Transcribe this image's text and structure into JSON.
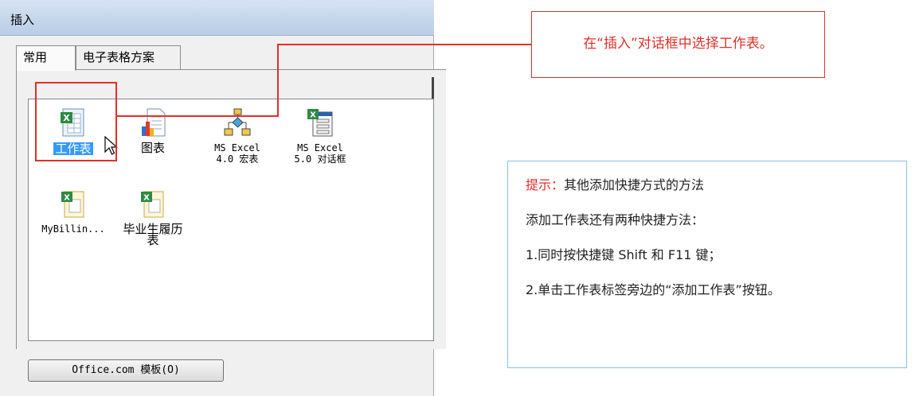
{
  "window": {
    "title": "插入"
  },
  "tabs": [
    {
      "label": "常用",
      "active": true
    },
    {
      "label": "电子表格方案",
      "active": false
    }
  ],
  "items": [
    {
      "label": "工作表",
      "icon": "excel-worksheet-icon",
      "selected": true
    },
    {
      "label": "图表",
      "icon": "chart-icon",
      "selected": false
    },
    {
      "label": "MS Excel\n4.0 宏表",
      "icon": "macro-sheet-icon",
      "selected": false
    },
    {
      "label": "MS Excel\n5.0 对话框",
      "icon": "dialog-sheet-icon",
      "selected": false
    },
    {
      "label": "MyBillin...",
      "icon": "excel-template-icon",
      "selected": false
    },
    {
      "label": "毕业生履历\n表",
      "icon": "excel-template-icon",
      "selected": false
    }
  ],
  "office_button": {
    "label": "Office.com 模板(O)"
  },
  "callout": {
    "text": "在“插入”对话框中选择工作表。"
  },
  "tip": {
    "prefix": "提示：",
    "title": "其他添加快捷方式的方法",
    "line1": "添加工作表还有两种快捷方法：",
    "line2": "1.同时按快捷键 Shift 和 F11 键；",
    "line3": "2.单击工作表标签旁边的“添加工作表”按钮。"
  },
  "colors": {
    "accent_red": "#e0302a",
    "selection_blue": "#3399ff",
    "tip_border": "#8fbfe0"
  }
}
